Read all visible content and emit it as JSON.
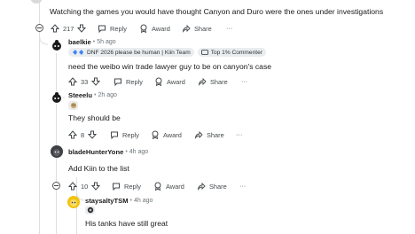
{
  "top_comment": {
    "text": "Watching the games you would have thought Canyon and Duro were the ones under investigations",
    "score": "217",
    "reply_label": "Reply",
    "award_label": "Award",
    "share_label": "Share",
    "more_label": "···"
  },
  "comments": [
    {
      "username": "baelkie",
      "time": "5h ago",
      "flair_main": "DNF 2026 please be human | Kiin Team",
      "flair_badge": "Top 1% Commenter",
      "text": "need the weibo win trade lawyer guy to be on canyon's case",
      "score": "33",
      "reply_label": "Reply",
      "award_label": "Award",
      "share_label": "Share",
      "more_label": "···"
    },
    {
      "username": "Steeelu",
      "time": "2h ago",
      "text": "They should be",
      "score": "8",
      "reply_label": "Reply",
      "award_label": "Award",
      "share_label": "Share",
      "more_label": "···"
    },
    {
      "username": "bladeHunterYone",
      "time": "4h ago",
      "text": "Add Kiin to the list",
      "score": "10",
      "reply_label": "Reply",
      "award_label": "Award",
      "share_label": "Share",
      "more_label": "···"
    },
    {
      "username": "staysaltyTSM",
      "time": "4h ago",
      "text": "His tanks have still great"
    }
  ],
  "colors": {
    "text": "#1a1a1b",
    "meta": "#6b7478",
    "thread_line": "#dcdfe1",
    "flair_bg": "#eaedef",
    "avatar_bladehunter": "#3d3f44",
    "avatar_staysalty": "#f1c40f"
  }
}
